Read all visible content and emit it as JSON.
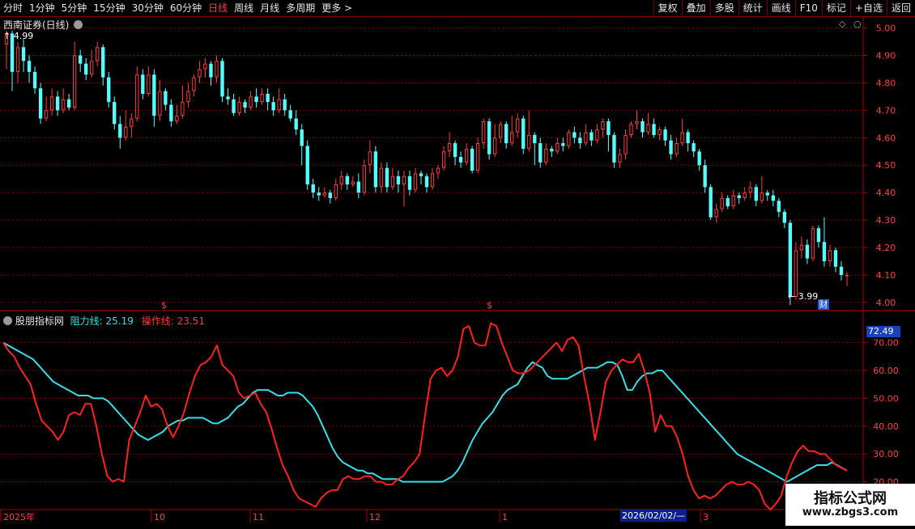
{
  "toolbar": {
    "tabs": [
      "分时",
      "1分钟",
      "5分钟",
      "15分钟",
      "30分钟",
      "60分钟",
      "日线",
      "周线",
      "月线",
      "多周期",
      "更多 >"
    ],
    "active_tab": "日线",
    "actions": [
      "复权",
      "叠加",
      "多股",
      "统计",
      "画线",
      "F10",
      "标记",
      "+自选",
      "返回"
    ]
  },
  "main_panel": {
    "title": "西南证券(日线)",
    "high_label": "4.99",
    "low_label": "3.99",
    "event_marker": "财",
    "dividend_markers": [
      "$",
      "$"
    ]
  },
  "indicator_panel": {
    "name": "股朋指标网",
    "line1_label": "阻力线:",
    "line1_value": "25.19",
    "line2_label": "操作线:",
    "line2_value": "23.51",
    "current_value_tag": "72.49"
  },
  "x_axis": {
    "labels": [
      "2025年",
      "10",
      "11",
      "12",
      "1",
      "3"
    ],
    "cursor_date": "2026/02/02/—"
  },
  "watermark": {
    "line1": "指标公式网",
    "line2": "www.zbgs3.com"
  },
  "colors": {
    "up": "#ff3b3b",
    "down": "#54ffff",
    "grid": "#8a0000",
    "text": "#e6e6e6"
  },
  "chart_data": [
    {
      "type": "candlestick",
      "series_name": "西南证券(日线)",
      "ylim": [
        3.97,
        5.04
      ],
      "y_ticks": [
        4.0,
        4.1,
        4.2,
        4.3,
        4.4,
        4.5,
        4.6,
        4.7,
        4.8,
        4.9,
        5.0
      ],
      "candles": [
        [
          4.94,
          4.98,
          4.99,
          4.85
        ],
        [
          4.98,
          4.84,
          4.99,
          4.77
        ],
        [
          4.84,
          4.93,
          4.95,
          4.8
        ],
        [
          4.93,
          4.88,
          4.96,
          4.84
        ],
        [
          4.88,
          4.84,
          4.9,
          4.8
        ],
        [
          4.84,
          4.78,
          4.86,
          4.76
        ],
        [
          4.78,
          4.67,
          4.8,
          4.65
        ],
        [
          4.67,
          4.7,
          4.75,
          4.66
        ],
        [
          4.7,
          4.75,
          4.78,
          4.68
        ],
        [
          4.75,
          4.7,
          4.77,
          4.68
        ],
        [
          4.7,
          4.74,
          4.78,
          4.69
        ],
        [
          4.74,
          4.71,
          4.76,
          4.7
        ],
        [
          4.71,
          4.9,
          4.95,
          4.7
        ],
        [
          4.9,
          4.87,
          4.92,
          4.84
        ],
        [
          4.87,
          4.83,
          4.89,
          4.81
        ],
        [
          4.83,
          4.88,
          4.92,
          4.82
        ],
        [
          4.88,
          4.93,
          4.95,
          4.86
        ],
        [
          4.93,
          4.82,
          4.94,
          4.79
        ],
        [
          4.82,
          4.73,
          4.84,
          4.71
        ],
        [
          4.73,
          4.65,
          4.75,
          4.63
        ],
        [
          4.65,
          4.6,
          4.68,
          4.56
        ],
        [
          4.6,
          4.64,
          4.7,
          4.59
        ],
        [
          4.64,
          4.67,
          4.69,
          4.6
        ],
        [
          4.67,
          4.83,
          4.86,
          4.66
        ],
        [
          4.83,
          4.76,
          4.85,
          4.74
        ],
        [
          4.76,
          4.83,
          4.86,
          4.75
        ],
        [
          4.83,
          4.68,
          4.85,
          4.64
        ],
        [
          4.68,
          4.77,
          4.81,
          4.66
        ],
        [
          4.77,
          4.72,
          4.78,
          4.7
        ],
        [
          4.72,
          4.66,
          4.74,
          4.64
        ],
        [
          4.66,
          4.68,
          4.72,
          4.65
        ],
        [
          4.68,
          4.73,
          4.79,
          4.67
        ],
        [
          4.73,
          4.77,
          4.8,
          4.71
        ],
        [
          4.77,
          4.82,
          4.83,
          4.75
        ],
        [
          4.82,
          4.85,
          4.88,
          4.8
        ],
        [
          4.85,
          4.87,
          4.89,
          4.82
        ],
        [
          4.87,
          4.82,
          4.88,
          4.79
        ],
        [
          4.82,
          4.88,
          4.9,
          4.8
        ],
        [
          4.88,
          4.75,
          4.89,
          4.73
        ],
        [
          4.75,
          4.74,
          4.78,
          4.72
        ],
        [
          4.74,
          4.69,
          4.76,
          4.68
        ],
        [
          4.69,
          4.73,
          4.75,
          4.68
        ],
        [
          4.73,
          4.71,
          4.74,
          4.69
        ],
        [
          4.71,
          4.75,
          4.77,
          4.7
        ],
        [
          4.75,
          4.73,
          4.78,
          4.71
        ],
        [
          4.73,
          4.76,
          4.78,
          4.72
        ],
        [
          4.76,
          4.73,
          4.78,
          4.7
        ],
        [
          4.73,
          4.7,
          4.75,
          4.68
        ],
        [
          4.7,
          4.74,
          4.78,
          4.69
        ],
        [
          4.74,
          4.7,
          4.76,
          4.68
        ],
        [
          4.7,
          4.67,
          4.72,
          4.66
        ],
        [
          4.67,
          4.63,
          4.7,
          4.61
        ],
        [
          4.63,
          4.57,
          4.65,
          4.5
        ],
        [
          4.57,
          4.43,
          4.59,
          4.41
        ],
        [
          4.43,
          4.4,
          4.45,
          4.38
        ],
        [
          4.4,
          4.39,
          4.42,
          4.37
        ],
        [
          4.39,
          4.4,
          4.42,
          4.38
        ],
        [
          4.4,
          4.38,
          4.41,
          4.36
        ],
        [
          4.38,
          4.43,
          4.45,
          4.37
        ],
        [
          4.43,
          4.46,
          4.48,
          4.41
        ],
        [
          4.46,
          4.43,
          4.47,
          4.41
        ],
        [
          4.43,
          4.44,
          4.46,
          4.42
        ],
        [
          4.44,
          4.4,
          4.47,
          4.38
        ],
        [
          4.4,
          4.5,
          4.52,
          4.39
        ],
        [
          4.5,
          4.55,
          4.59,
          4.47
        ],
        [
          4.55,
          4.42,
          4.57,
          4.4
        ],
        [
          4.42,
          4.49,
          4.51,
          4.4
        ],
        [
          4.49,
          4.42,
          4.51,
          4.4
        ],
        [
          4.42,
          4.46,
          4.49,
          4.41
        ],
        [
          4.46,
          4.43,
          4.48,
          4.4
        ],
        [
          4.43,
          4.46,
          4.48,
          4.35
        ],
        [
          4.46,
          4.41,
          4.48,
          4.39
        ],
        [
          4.41,
          4.47,
          4.49,
          4.4
        ],
        [
          4.47,
          4.46,
          4.48,
          4.43
        ],
        [
          4.46,
          4.42,
          4.47,
          4.4
        ],
        [
          4.42,
          4.47,
          4.49,
          4.41
        ],
        [
          4.47,
          4.49,
          4.5,
          4.45
        ],
        [
          4.49,
          4.55,
          4.57,
          4.48
        ],
        [
          4.55,
          4.58,
          4.62,
          4.53
        ],
        [
          4.58,
          4.53,
          4.59,
          4.5
        ],
        [
          4.53,
          4.51,
          4.55,
          4.49
        ],
        [
          4.51,
          4.56,
          4.58,
          4.5
        ],
        [
          4.56,
          4.48,
          4.57,
          4.47
        ],
        [
          4.48,
          4.58,
          4.6,
          4.47
        ],
        [
          4.58,
          4.66,
          4.67,
          4.56
        ],
        [
          4.66,
          4.54,
          4.67,
          4.52
        ],
        [
          4.54,
          4.6,
          4.65,
          4.53
        ],
        [
          4.6,
          4.65,
          4.66,
          4.58
        ],
        [
          4.65,
          4.58,
          4.66,
          4.56
        ],
        [
          4.58,
          4.62,
          4.68,
          4.57
        ],
        [
          4.62,
          4.67,
          4.69,
          4.6
        ],
        [
          4.67,
          4.56,
          4.68,
          4.54
        ],
        [
          4.56,
          4.61,
          4.7,
          4.55
        ],
        [
          4.61,
          4.58,
          4.62,
          4.5
        ],
        [
          4.58,
          4.51,
          4.6,
          4.49
        ],
        [
          4.51,
          4.56,
          4.58,
          4.5
        ],
        [
          4.56,
          4.55,
          4.57,
          4.53
        ],
        [
          4.55,
          4.58,
          4.6,
          4.54
        ],
        [
          4.58,
          4.57,
          4.6,
          4.55
        ],
        [
          4.57,
          4.62,
          4.63,
          4.56
        ],
        [
          4.62,
          4.6,
          4.64,
          4.58
        ],
        [
          4.6,
          4.58,
          4.62,
          4.56
        ],
        [
          4.58,
          4.62,
          4.65,
          4.57
        ],
        [
          4.62,
          4.59,
          4.63,
          4.57
        ],
        [
          4.59,
          4.63,
          4.65,
          4.58
        ],
        [
          4.63,
          4.66,
          4.67,
          4.6
        ],
        [
          4.66,
          4.61,
          4.67,
          4.55
        ],
        [
          4.61,
          4.51,
          4.62,
          4.49
        ],
        [
          4.51,
          4.54,
          4.56,
          4.49
        ],
        [
          4.54,
          4.61,
          4.63,
          4.52
        ],
        [
          4.61,
          4.65,
          4.66,
          4.6
        ],
        [
          4.65,
          4.66,
          4.7,
          4.63
        ],
        [
          4.66,
          4.62,
          4.67,
          4.6
        ],
        [
          4.62,
          4.65,
          4.69,
          4.61
        ],
        [
          4.65,
          4.61,
          4.67,
          4.6
        ],
        [
          4.61,
          4.63,
          4.64,
          4.59
        ],
        [
          4.63,
          4.59,
          4.64,
          4.57
        ],
        [
          4.59,
          4.54,
          4.61,
          4.52
        ],
        [
          4.54,
          4.58,
          4.6,
          4.53
        ],
        [
          4.58,
          4.62,
          4.67,
          4.57
        ],
        [
          4.62,
          4.58,
          4.63,
          4.55
        ],
        [
          4.58,
          4.55,
          4.59,
          4.53
        ],
        [
          4.55,
          4.5,
          4.56,
          4.48
        ],
        [
          4.5,
          4.42,
          4.52,
          4.4
        ],
        [
          4.42,
          4.31,
          4.43,
          4.3
        ],
        [
          4.31,
          4.34,
          4.36,
          4.29
        ],
        [
          4.34,
          4.38,
          4.4,
          4.33
        ],
        [
          4.38,
          4.35,
          4.39,
          4.34
        ],
        [
          4.35,
          4.39,
          4.41,
          4.34
        ],
        [
          4.39,
          4.38,
          4.4,
          4.36
        ],
        [
          4.38,
          4.4,
          4.42,
          4.37
        ],
        [
          4.4,
          4.42,
          4.44,
          4.38
        ],
        [
          4.42,
          4.37,
          4.43,
          4.35
        ],
        [
          4.37,
          4.4,
          4.46,
          4.36
        ],
        [
          4.4,
          4.39,
          4.41,
          4.37
        ],
        [
          4.39,
          4.37,
          4.41,
          4.35
        ],
        [
          4.37,
          4.33,
          4.38,
          4.31
        ],
        [
          4.33,
          4.29,
          4.34,
          4.27
        ],
        [
          4.29,
          4.02,
          4.3,
          3.99
        ],
        [
          4.02,
          4.19,
          4.22,
          4.01
        ],
        [
          4.19,
          4.21,
          4.24,
          4.16
        ],
        [
          4.21,
          4.16,
          4.23,
          4.14
        ],
        [
          4.16,
          4.27,
          4.28,
          4.15
        ],
        [
          4.27,
          4.22,
          4.28,
          4.2
        ],
        [
          4.22,
          4.15,
          4.31,
          4.13
        ],
        [
          4.15,
          4.19,
          4.21,
          4.13
        ],
        [
          4.19,
          4.13,
          4.2,
          4.11
        ],
        [
          4.13,
          4.1,
          4.15,
          4.08
        ],
        [
          4.1,
          4.1,
          4.11,
          4.06
        ]
      ]
    },
    {
      "type": "line",
      "ylim": [
        10,
        76
      ],
      "y_ticks": [
        20,
        30,
        40,
        50,
        60,
        70
      ],
      "series": [
        {
          "name": "阻力线",
          "color": "#33e0e8",
          "values": [
            70,
            69,
            68,
            67,
            66,
            65,
            64,
            62,
            60,
            58,
            56,
            55,
            54,
            53,
            52,
            51,
            51,
            51,
            50,
            50,
            50,
            49,
            47,
            45,
            43,
            41,
            39,
            37,
            36,
            35,
            36,
            37,
            38,
            40,
            41,
            42,
            42,
            43,
            43,
            43,
            43,
            42,
            41,
            41,
            42,
            43,
            45,
            47,
            48,
            50,
            52,
            53,
            53,
            53,
            52,
            51,
            51,
            52,
            52,
            52,
            51,
            49,
            47,
            44,
            40,
            36,
            32,
            29,
            27,
            26,
            25,
            24,
            24,
            23,
            23,
            22,
            21,
            21,
            21,
            21,
            20,
            20,
            20,
            20,
            20,
            20,
            20,
            20,
            20,
            21,
            22,
            24,
            27,
            31,
            35,
            38,
            41,
            43,
            45,
            48,
            51,
            53,
            54,
            55,
            58,
            61,
            63,
            62,
            61,
            58,
            57,
            57,
            57,
            57,
            58,
            59,
            60,
            61,
            61,
            61,
            62,
            63,
            63,
            62,
            58,
            53,
            53,
            56,
            58,
            59,
            59,
            60,
            60,
            58,
            56,
            54,
            52,
            50,
            48,
            46,
            44,
            42,
            40,
            38,
            36,
            34,
            32,
            30,
            29,
            28,
            27,
            26,
            25,
            24,
            23,
            22,
            21,
            20,
            21,
            22,
            23,
            24,
            25,
            26,
            26,
            26,
            27,
            26,
            25,
            24
          ]
        },
        {
          "name": "操作线",
          "color": "#ff2020",
          "values": [
            70,
            67,
            65,
            61,
            58,
            55,
            48,
            42,
            40,
            38,
            35,
            38,
            44,
            45,
            44,
            48,
            48,
            40,
            30,
            22,
            20,
            21,
            20,
            35,
            40,
            45,
            51,
            47,
            48,
            46,
            40,
            36,
            40,
            45,
            52,
            58,
            62,
            63,
            65,
            69,
            62,
            60,
            58,
            52,
            50,
            51,
            52,
            48,
            45,
            39,
            32,
            26,
            22,
            17,
            14,
            13,
            12,
            11,
            14,
            16,
            17,
            17,
            21,
            22,
            21,
            21,
            22,
            22,
            20,
            20,
            19,
            19,
            21,
            22,
            25,
            27,
            30,
            44,
            57,
            60,
            61,
            58,
            60,
            65,
            75,
            76,
            70,
            69,
            69,
            77,
            76,
            70,
            65,
            60,
            59,
            59,
            60,
            62,
            64,
            66,
            68,
            70,
            67,
            71,
            72,
            69,
            58,
            48,
            35,
            45,
            56,
            60,
            62,
            64,
            63,
            63,
            66,
            60,
            52,
            38,
            44,
            40,
            40,
            36,
            30,
            22,
            17,
            14,
            15,
            14,
            15,
            17,
            19,
            20,
            19,
            19,
            20,
            19,
            17,
            12,
            10,
            12,
            15,
            22,
            27,
            31,
            33,
            31,
            31,
            30,
            30,
            28,
            26,
            25,
            24
          ]
        }
      ]
    }
  ]
}
